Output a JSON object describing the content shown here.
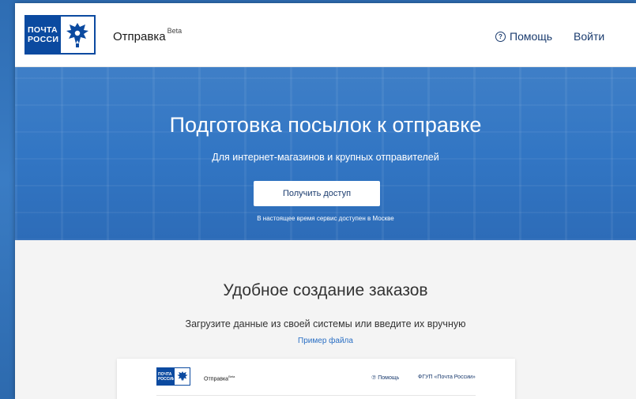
{
  "header": {
    "logo_line1": "ПОЧТА",
    "logo_line2": "РОССИИ",
    "app_name": "Отправка",
    "app_badge": "Beta",
    "help_label": "Помощь",
    "login_label": "Войти"
  },
  "hero": {
    "title": "Подготовка посылок к отправке",
    "subtitle": "Для интернет-магазинов и крупных отправителей",
    "cta_label": "Получить доступ",
    "note": "В настоящее время сервис доступен в Москве"
  },
  "section": {
    "title": "Удобное создание заказов",
    "subtitle": "Загрузите данные из своей системы или введите их вручную",
    "link": "Пример файла"
  },
  "preview": {
    "logo_line1": "ПОЧТА",
    "logo_line2": "РОССИИ",
    "app_name": "Отправка",
    "app_badge": "Beta",
    "help_label": "⑦ Помощь",
    "org_label": "ФГУП «Почта России»"
  },
  "colors": {
    "brand_blue": "#0b4aa0",
    "hero_blue": "#3276c4",
    "link_blue": "#2a6fc4"
  },
  "icons": {
    "help": "question-circle-icon",
    "emblem": "eagle-emblem-icon"
  }
}
